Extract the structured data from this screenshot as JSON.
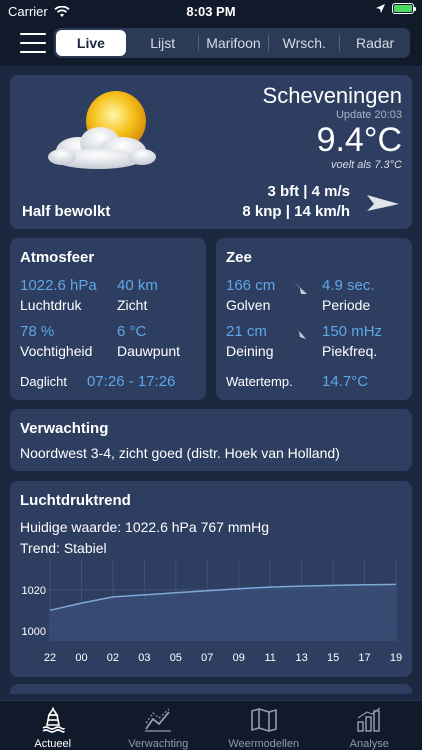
{
  "status_bar": {
    "carrier": "Carrier",
    "time": "8:03 PM"
  },
  "nav": {
    "tabs": [
      "Live",
      "Lijst",
      "Marifoon",
      "Wrsch.",
      "Radar"
    ],
    "active_tab": "Live"
  },
  "current": {
    "location": "Scheveningen",
    "update": "Update 20:03",
    "temperature": "9.4°C",
    "feels_like": "voelt als 7.3°C",
    "wind_bft_ms": "3 bft | 4 m/s",
    "wind_knp_kmh": "8 knp | 14 km/h",
    "condition": "Half bewolkt",
    "weather_icon": "partly-cloudy-icon",
    "wind_direction_icon": "wind-arrow-icon"
  },
  "atmosfeer": {
    "title": "Atmosfeer",
    "pressure_value": "1022.6 hPa",
    "pressure_label": "Luchtdruk",
    "visibility_value": "40 km",
    "visibility_label": "Zicht",
    "humidity_value": "78 %",
    "humidity_label": "Vochtigheid",
    "dewpoint_value": "6 °C",
    "dewpoint_label": "Dauwpunt",
    "daylight_label": "Daglicht",
    "daylight_value": "07:26 - 17:26"
  },
  "zee": {
    "title": "Zee",
    "waves_value": "166 cm",
    "waves_label": "Golven",
    "period_value": "4.9 sec.",
    "period_label": "Periode",
    "swell_value": "21 cm",
    "swell_label": "Deining",
    "peakfreq_value": "150 mHz",
    "peakfreq_label": "Piekfreq.",
    "watertemp_label": "Watertemp.",
    "watertemp_value": "14.7°C"
  },
  "verwachting": {
    "title": "Verwachting",
    "text": "Noordwest 3-4, zicht goed (distr. Hoek van Holland)"
  },
  "luchtdruktrend": {
    "title": "Luchtdruktrend",
    "current": "Huidige waarde: 1022.6 hPa 767 mmHg",
    "trend": "Trend: Stabiel"
  },
  "chart_data": {
    "type": "area",
    "x": [
      "22",
      "00",
      "02",
      "03",
      "05",
      "07",
      "09",
      "11",
      "13",
      "15",
      "17",
      "19"
    ],
    "values": [
      1010,
      1013.5,
      1016.5,
      1017.5,
      1018.5,
      1019.5,
      1020.5,
      1021.3,
      1021.8,
      1022.1,
      1022.4,
      1022.6
    ],
    "yticks": [
      1000,
      1020
    ],
    "ylim": [
      995,
      1035
    ],
    "grid": true,
    "colors": {
      "line": "#7fa8d6",
      "fill": "#3a4f78"
    }
  },
  "tabbar": {
    "items": [
      {
        "label": "Actueel",
        "icon": "buoy-icon",
        "active": true
      },
      {
        "label": "Verwachting",
        "icon": "trend-icon",
        "active": false
      },
      {
        "label": "Weermodellen",
        "icon": "map-icon",
        "active": false
      },
      {
        "label": "Analyse",
        "icon": "bar-chart-icon",
        "active": false
      }
    ]
  }
}
